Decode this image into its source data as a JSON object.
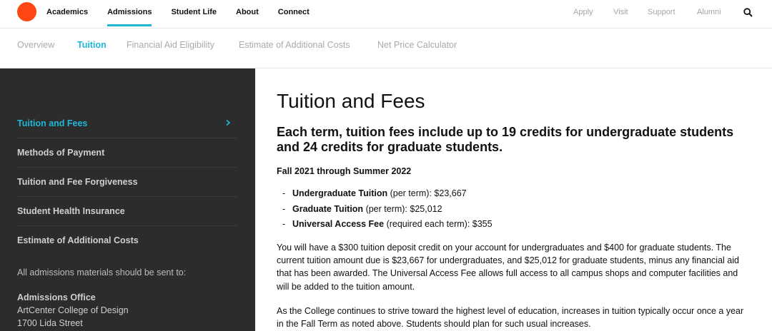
{
  "nav": {
    "primary": [
      "Academics",
      "Admissions",
      "Student Life",
      "About",
      "Connect"
    ],
    "active_primary": "Admissions",
    "utility": [
      "Apply",
      "Visit",
      "Support",
      "Alumni"
    ]
  },
  "subnav": {
    "items": [
      "Overview",
      "Tuition",
      "Financial Aid Eligibility",
      "Estimate of Additional Costs",
      "Net Price Calculator"
    ],
    "active": "Tuition"
  },
  "sidebar": {
    "links": [
      "Tuition and Fees",
      "Methods of Payment",
      "Tuition and Fee Forgiveness",
      "Student Health Insurance",
      "Estimate of Additional Costs"
    ],
    "active": "Tuition and Fees",
    "note": "All admissions materials should be sent to:",
    "address": {
      "name": "Admissions Office",
      "line1": "ArtCenter College of Design",
      "line2": "1700 Lida Street"
    }
  },
  "main": {
    "title": "Tuition and Fees",
    "lead": "Each term, tuition fees include up to 19 credits for undergraduate students and 24 credits for graduate students.",
    "period": "Fall 2021 through Summer 2022",
    "fees": [
      {
        "label": "Undergraduate Tuition",
        "qualifier": "(per term):",
        "amount": "$23,667"
      },
      {
        "label": "Graduate Tuition",
        "qualifier": "(per term):",
        "amount": "$25,012"
      },
      {
        "label": "Universal Access Fee",
        "qualifier": "(required each term):",
        "amount": "$355"
      }
    ],
    "paragraph1": "You will have a $300 tuition deposit credit on your account for undergraduates and $400 for graduate students. The current tuition amount due is $23,667 for undergraduates, and $25,012 for graduate students, minus any financial aid that has been awarded. The Universal Access Fee allows full access to all campus shops and computer facilities and will be added to the tuition amount.",
    "paragraph2": "As the College continues to strive toward the highest level of education, increases in tuition typically occur once a year in the Fall Term as noted above. Students should plan for such usual increases."
  },
  "colors": {
    "accent": "#1fb8d8",
    "logo": "#ff4713",
    "sidebar_bg": "#2c2c2c"
  }
}
